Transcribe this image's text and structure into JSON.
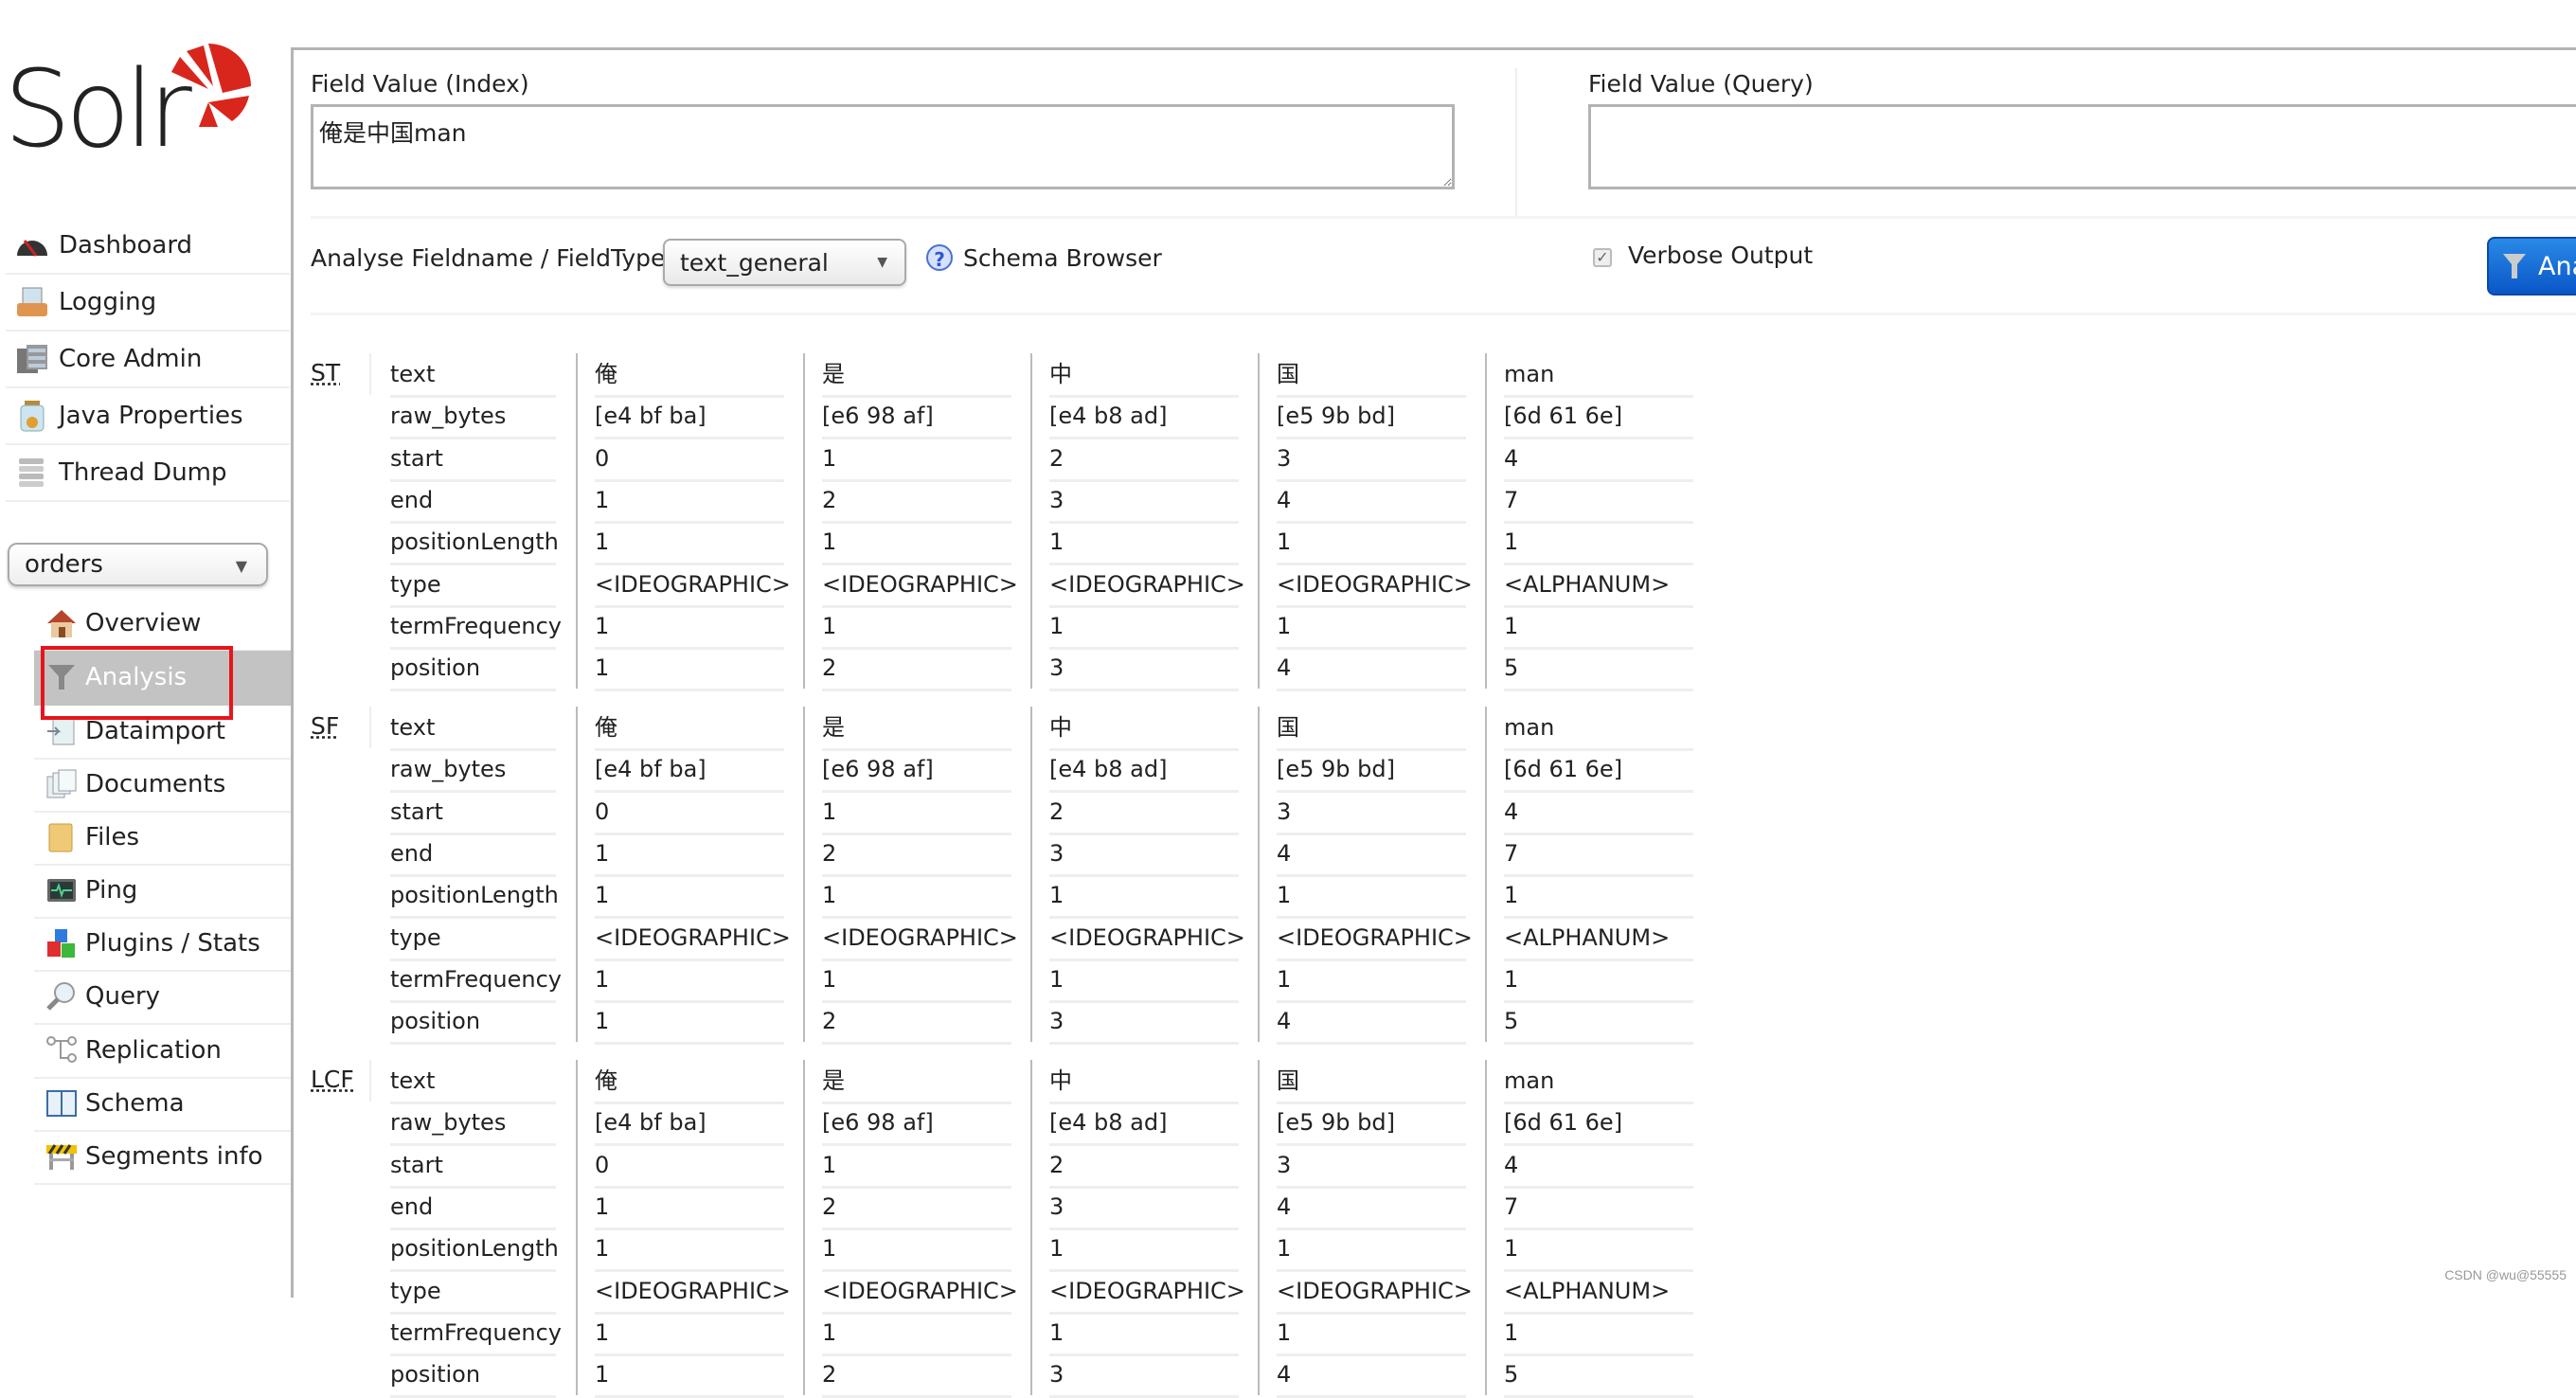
{
  "logo": {
    "text": "Solr"
  },
  "sidebar": {
    "items": [
      {
        "label": "Dashboard",
        "icon": "dashboard-gauge-icon"
      },
      {
        "label": "Logging",
        "icon": "logging-inbox-icon"
      },
      {
        "label": "Core Admin",
        "icon": "core-admin-server-icon"
      },
      {
        "label": "Java Properties",
        "icon": "java-properties-jar-icon"
      },
      {
        "label": "Thread Dump",
        "icon": "thread-dump-stack-icon"
      }
    ],
    "core_selector": {
      "value": "orders",
      "caret": "▼"
    },
    "core_items": [
      {
        "label": "Overview",
        "icon": "overview-house-icon"
      },
      {
        "label": "Analysis",
        "icon": "analysis-funnel-icon",
        "active": true
      },
      {
        "label": "Dataimport",
        "icon": "dataimport-icon"
      },
      {
        "label": "Documents",
        "icon": "documents-icon"
      },
      {
        "label": "Files",
        "icon": "files-folder-icon"
      },
      {
        "label": "Ping",
        "icon": "ping-monitor-icon"
      },
      {
        "label": "Plugins / Stats",
        "icon": "plugins-blocks-icon"
      },
      {
        "label": "Query",
        "icon": "query-magnifier-icon"
      },
      {
        "label": "Replication",
        "icon": "replication-icon"
      },
      {
        "label": "Schema",
        "icon": "schema-book-icon"
      },
      {
        "label": "Segments info",
        "icon": "segments-barrier-icon"
      }
    ]
  },
  "analysis": {
    "index_label": "Field Value (Index)",
    "index_value": "俺是中国man",
    "query_label": "Field Value (Query)",
    "query_value": "",
    "fieldtype_label": "Analyse Fieldname / FieldType:",
    "fieldtype_value": "text_general",
    "schema_browser_label": "Schema Browser",
    "verbose_label": "Verbose Output",
    "verbose_checked": true,
    "analyse_button_label": "Analyse Values",
    "analyse_button_visible_label": "Ana"
  },
  "result_keys": [
    "text",
    "raw_bytes",
    "start",
    "end",
    "positionLength",
    "type",
    "termFrequency",
    "position"
  ],
  "stages": [
    {
      "name": "ST",
      "tokens": [
        {
          "text": "俺",
          "raw_bytes": "[e4 bf ba]",
          "start": "0",
          "end": "1",
          "positionLength": "1",
          "type": "<IDEOGRAPHIC>",
          "termFrequency": "1",
          "position": "1"
        },
        {
          "text": "是",
          "raw_bytes": "[e6 98 af]",
          "start": "1",
          "end": "2",
          "positionLength": "1",
          "type": "<IDEOGRAPHIC>",
          "termFrequency": "1",
          "position": "2"
        },
        {
          "text": "中",
          "raw_bytes": "[e4 b8 ad]",
          "start": "2",
          "end": "3",
          "positionLength": "1",
          "type": "<IDEOGRAPHIC>",
          "termFrequency": "1",
          "position": "3"
        },
        {
          "text": "国",
          "raw_bytes": "[e5 9b bd]",
          "start": "3",
          "end": "4",
          "positionLength": "1",
          "type": "<IDEOGRAPHIC>",
          "termFrequency": "1",
          "position": "4"
        },
        {
          "text": "man",
          "raw_bytes": "[6d 61 6e]",
          "start": "4",
          "end": "7",
          "positionLength": "1",
          "type": "<ALPHANUM>",
          "termFrequency": "1",
          "position": "5"
        }
      ]
    },
    {
      "name": "SF",
      "tokens": [
        {
          "text": "俺",
          "raw_bytes": "[e4 bf ba]",
          "start": "0",
          "end": "1",
          "positionLength": "1",
          "type": "<IDEOGRAPHIC>",
          "termFrequency": "1",
          "position": "1"
        },
        {
          "text": "是",
          "raw_bytes": "[e6 98 af]",
          "start": "1",
          "end": "2",
          "positionLength": "1",
          "type": "<IDEOGRAPHIC>",
          "termFrequency": "1",
          "position": "2"
        },
        {
          "text": "中",
          "raw_bytes": "[e4 b8 ad]",
          "start": "2",
          "end": "3",
          "positionLength": "1",
          "type": "<IDEOGRAPHIC>",
          "termFrequency": "1",
          "position": "3"
        },
        {
          "text": "国",
          "raw_bytes": "[e5 9b bd]",
          "start": "3",
          "end": "4",
          "positionLength": "1",
          "type": "<IDEOGRAPHIC>",
          "termFrequency": "1",
          "position": "4"
        },
        {
          "text": "man",
          "raw_bytes": "[6d 61 6e]",
          "start": "4",
          "end": "7",
          "positionLength": "1",
          "type": "<ALPHANUM>",
          "termFrequency": "1",
          "position": "5"
        }
      ]
    },
    {
      "name": "LCF",
      "tokens": [
        {
          "text": "俺",
          "raw_bytes": "[e4 bf ba]",
          "start": "0",
          "end": "1",
          "positionLength": "1",
          "type": "<IDEOGRAPHIC>",
          "termFrequency": "1",
          "position": "1"
        },
        {
          "text": "是",
          "raw_bytes": "[e6 98 af]",
          "start": "1",
          "end": "2",
          "positionLength": "1",
          "type": "<IDEOGRAPHIC>",
          "termFrequency": "1",
          "position": "2"
        },
        {
          "text": "中",
          "raw_bytes": "[e4 b8 ad]",
          "start": "2",
          "end": "3",
          "positionLength": "1",
          "type": "<IDEOGRAPHIC>",
          "termFrequency": "1",
          "position": "3"
        },
        {
          "text": "国",
          "raw_bytes": "[e5 9b bd]",
          "start": "3",
          "end": "4",
          "positionLength": "1",
          "type": "<IDEOGRAPHIC>",
          "termFrequency": "1",
          "position": "4"
        },
        {
          "text": "man",
          "raw_bytes": "[6d 61 6e]",
          "start": "4",
          "end": "7",
          "positionLength": "1",
          "type": "<ALPHANUM>",
          "termFrequency": "1",
          "position": "5"
        }
      ]
    }
  ],
  "colors": {
    "accent_red": "#d9261c",
    "selected_bg": "#c3c3c3",
    "button_blue": "#0a56c8",
    "highlight_box": "#e8141b"
  },
  "watermark": "CSDN @wu@55555"
}
